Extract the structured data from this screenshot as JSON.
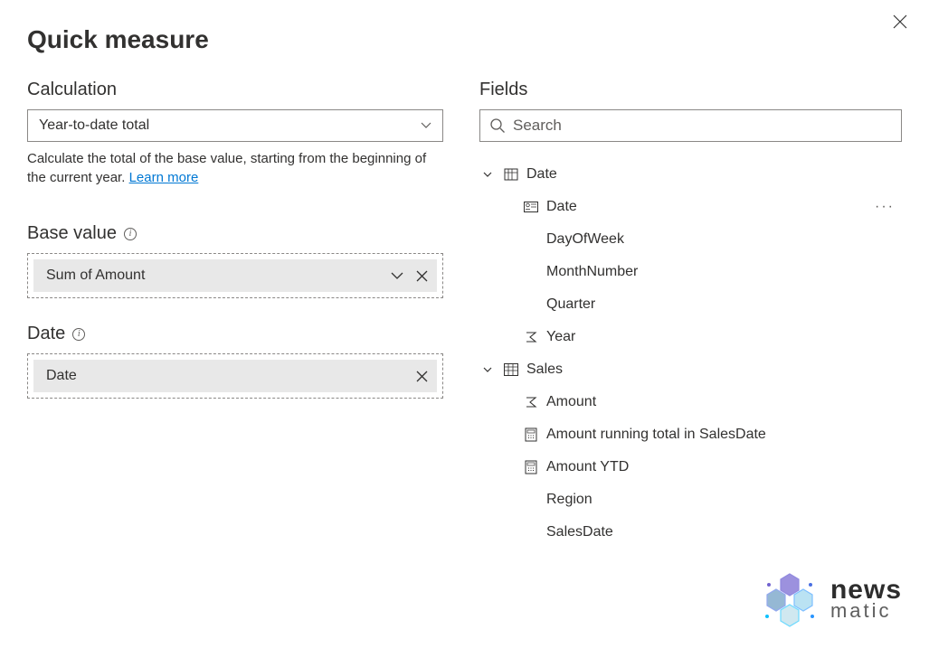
{
  "dialog": {
    "title": "Quick measure",
    "close_label": "Close"
  },
  "calculation": {
    "label": "Calculation",
    "selected": "Year-to-date total",
    "description": "Calculate the total of the base value, starting from the beginning of the current year.",
    "learn_more": "Learn more"
  },
  "base_value": {
    "label": "Base value",
    "value": "Sum of Amount"
  },
  "date_field": {
    "label": "Date",
    "value": "Date"
  },
  "fields_panel": {
    "label": "Fields",
    "search_placeholder": "Search",
    "tables": [
      {
        "name": "Date",
        "icon": "calendar-table",
        "expanded": true,
        "columns": [
          {
            "name": "Date",
            "icon": "identity",
            "more": true
          },
          {
            "name": "DayOfWeek",
            "icon": ""
          },
          {
            "name": "MonthNumber",
            "icon": ""
          },
          {
            "name": "Quarter",
            "icon": ""
          },
          {
            "name": "Year",
            "icon": "sigma"
          }
        ]
      },
      {
        "name": "Sales",
        "icon": "table",
        "expanded": true,
        "columns": [
          {
            "name": "Amount",
            "icon": "sigma"
          },
          {
            "name": "Amount running total in SalesDate",
            "icon": "measure"
          },
          {
            "name": "Amount YTD",
            "icon": "measure"
          },
          {
            "name": "Region",
            "icon": ""
          },
          {
            "name": "SalesDate",
            "icon": ""
          }
        ]
      }
    ]
  },
  "watermark": {
    "line1": "news",
    "line2": "matic"
  }
}
